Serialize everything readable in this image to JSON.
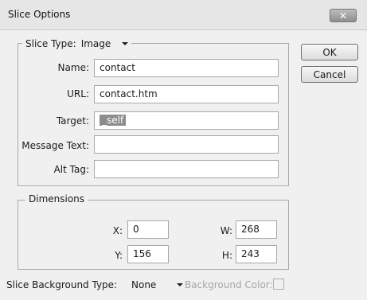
{
  "window": {
    "title": "Slice Options"
  },
  "buttons": {
    "ok": "OK",
    "cancel": "Cancel"
  },
  "slice_type": {
    "label": "Slice Type:",
    "value": "Image"
  },
  "fields": {
    "name": {
      "label": "Name:",
      "value": "contact"
    },
    "url": {
      "label": "URL:",
      "value": "contact.htm"
    },
    "target": {
      "label": "Target:",
      "value": "_self"
    },
    "message_text": {
      "label": "Message Text:",
      "value": ""
    },
    "alt_tag": {
      "label": "Alt Tag:",
      "value": ""
    }
  },
  "dimensions": {
    "label": "Dimensions",
    "x": {
      "label": "X:",
      "value": "0"
    },
    "y": {
      "label": "Y:",
      "value": "156"
    },
    "w": {
      "label": "W:",
      "value": "268"
    },
    "h": {
      "label": "H:",
      "value": "243"
    }
  },
  "background": {
    "type_label": "Slice Background Type:",
    "type_value": "None",
    "color_label": "Background Color:"
  },
  "icons": [
    "close-icon",
    "dropdown-arrow-icon"
  ]
}
